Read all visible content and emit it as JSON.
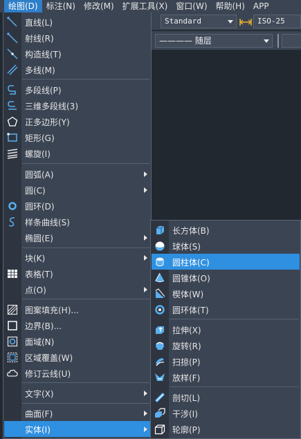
{
  "menubar": {
    "items": [
      {
        "label": "绘图(D)",
        "active": true
      },
      {
        "label": "标注(N)"
      },
      {
        "label": "修改(M)"
      },
      {
        "label": "扩展工具(X)"
      },
      {
        "label": "窗口(W)"
      },
      {
        "label": "帮助(H)"
      },
      {
        "label": "APP"
      }
    ]
  },
  "toolbar": {
    "text_style": "Standard",
    "dim_style": "ISO-25",
    "layer_linetype": "———— 随层"
  },
  "draw_menu": {
    "items": [
      {
        "label": "直线(L)",
        "icon": "line-icon"
      },
      {
        "label": "射线(R)",
        "icon": "ray-icon"
      },
      {
        "label": "构造线(T)",
        "icon": "construction-line-icon"
      },
      {
        "label": "多线(M)",
        "icon": "multiline-icon"
      },
      {
        "label": "多段线(P)",
        "icon": "polyline-icon"
      },
      {
        "label": "三维多段线(3)",
        "icon": "3d-polyline-icon"
      },
      {
        "label": "正多边形(Y)",
        "icon": "polygon-icon"
      },
      {
        "label": "矩形(G)",
        "icon": "rectangle-icon"
      },
      {
        "label": "螺旋(I)",
        "icon": "helix-icon"
      },
      {
        "label": "圆弧(A)",
        "icon": "",
        "submenu": true
      },
      {
        "label": "圆(C)",
        "icon": "",
        "submenu": true
      },
      {
        "label": "圆环(D)",
        "icon": "donut-icon"
      },
      {
        "label": "样条曲线(S)",
        "icon": "spline-icon"
      },
      {
        "label": "椭圆(E)",
        "icon": "",
        "submenu": true
      },
      {
        "label": "块(K)",
        "icon": "",
        "submenu": true
      },
      {
        "label": "表格(T)",
        "icon": "table-icon"
      },
      {
        "label": "点(O)",
        "icon": "",
        "submenu": true
      },
      {
        "label": "图案填充(H)...",
        "icon": "hatch-icon"
      },
      {
        "label": "边界(B)...",
        "icon": "boundary-icon"
      },
      {
        "label": "面域(N)",
        "icon": "region-icon"
      },
      {
        "label": "区域覆盖(W)",
        "icon": "wipeout-icon"
      },
      {
        "label": "修订云线(U)",
        "icon": "revcloud-icon"
      },
      {
        "label": "文字(X)",
        "icon": "",
        "submenu": true
      },
      {
        "label": "曲面(F)",
        "icon": "",
        "submenu": true
      },
      {
        "label": "实体(I)",
        "icon": "",
        "submenu": true,
        "highlighted": true
      }
    ]
  },
  "solid_menu": {
    "items": [
      {
        "label": "长方体(B)",
        "icon": "box-icon"
      },
      {
        "label": "球体(S)",
        "icon": "sphere-icon"
      },
      {
        "label": "圆柱体(C)",
        "icon": "cylinder-icon",
        "highlighted": true
      },
      {
        "label": "圆锥体(O)",
        "icon": "cone-icon"
      },
      {
        "label": "楔体(W)",
        "icon": "wedge-icon"
      },
      {
        "label": "圆环体(T)",
        "icon": "torus-icon"
      },
      {
        "label": "拉伸(X)",
        "icon": "extrude-icon"
      },
      {
        "label": "旋转(R)",
        "icon": "revolve-icon"
      },
      {
        "label": "扫掠(P)",
        "icon": "sweep-icon"
      },
      {
        "label": "放样(F)",
        "icon": "loft-icon"
      },
      {
        "label": "剖切(L)",
        "icon": "slice-icon"
      },
      {
        "label": "干涉(I)",
        "icon": "interfere-icon"
      },
      {
        "label": "轮廓(P)",
        "icon": "profile-icon"
      }
    ]
  },
  "colors": {
    "menu_bg": "#3b4453",
    "highlight": "#2f8fe0",
    "icon_blue": "#5ab0f0",
    "canvas": "#212830"
  }
}
